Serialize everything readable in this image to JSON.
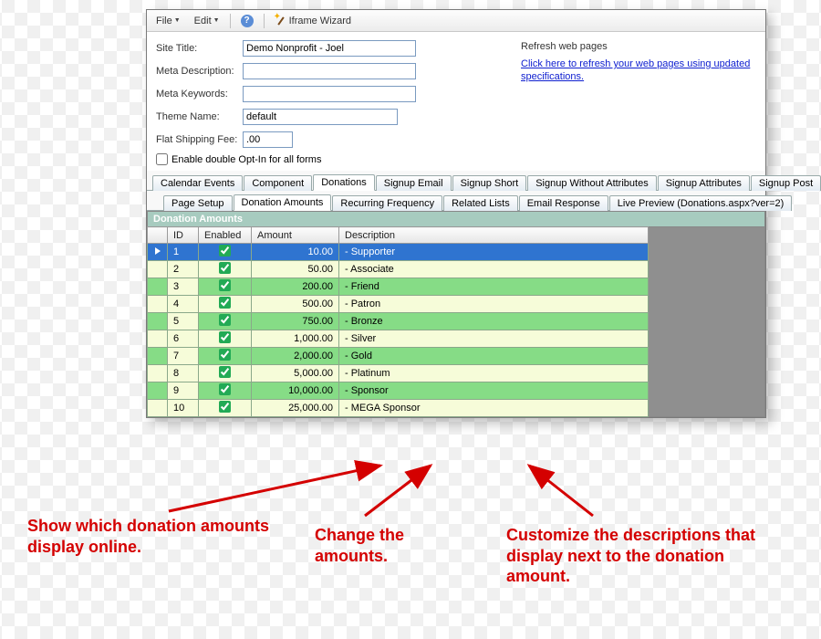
{
  "menubar": {
    "file": "File",
    "edit": "Edit",
    "wizard": "Iframe Wizard"
  },
  "form": {
    "site_title_label": "Site Title:",
    "site_title_value": "Demo Nonprofit - Joel",
    "meta_desc_label": "Meta Description:",
    "meta_desc_value": "",
    "meta_kw_label": "Meta Keywords:",
    "meta_kw_value": "",
    "theme_label": "Theme Name:",
    "theme_value": "default",
    "ship_label": "Flat Shipping Fee:",
    "ship_value": ".00",
    "optin_label": "Enable double Opt-In for all forms"
  },
  "refresh": {
    "header": "Refresh web pages",
    "link": "Click here to refresh your web pages using updated specifications."
  },
  "tabs": {
    "top": [
      "Calendar Events",
      "Component",
      "Donations",
      "Signup Email",
      "Signup Short",
      "Signup Without Attributes",
      "Signup Attributes",
      "Signup Post"
    ],
    "top_active": "Donations",
    "sub": [
      "Page Setup",
      "Donation Amounts",
      "Recurring Frequency",
      "Related Lists",
      "Email Response",
      "Live Preview (Donations.aspx?ver=2)"
    ],
    "sub_active": "Donation Amounts"
  },
  "grid": {
    "title": "Donation Amounts",
    "headers": {
      "id": "ID",
      "enabled": "Enabled",
      "amount": "Amount",
      "description": "Description"
    },
    "rows": [
      {
        "id": "1",
        "enabled": true,
        "amount": "10.00",
        "description": "- Supporter",
        "selected": true
      },
      {
        "id": "2",
        "enabled": true,
        "amount": "50.00",
        "description": "- Associate"
      },
      {
        "id": "3",
        "enabled": true,
        "amount": "200.00",
        "description": "- Friend"
      },
      {
        "id": "4",
        "enabled": true,
        "amount": "500.00",
        "description": "- Patron"
      },
      {
        "id": "5",
        "enabled": true,
        "amount": "750.00",
        "description": "- Bronze"
      },
      {
        "id": "6",
        "enabled": true,
        "amount": "1,000.00",
        "description": "- Silver"
      },
      {
        "id": "7",
        "enabled": true,
        "amount": "2,000.00",
        "description": "- Gold"
      },
      {
        "id": "8",
        "enabled": true,
        "amount": "5,000.00",
        "description": "- Platinum"
      },
      {
        "id": "9",
        "enabled": true,
        "amount": "10,000.00",
        "description": "- Sponsor"
      },
      {
        "id": "10",
        "enabled": true,
        "amount": "25,000.00",
        "description": "- MEGA Sponsor"
      }
    ]
  },
  "annotations": {
    "a1": "Show which donation amounts display online.",
    "a2": "Change the amounts.",
    "a3": "Customize the descriptions that display next to the donation amount."
  }
}
